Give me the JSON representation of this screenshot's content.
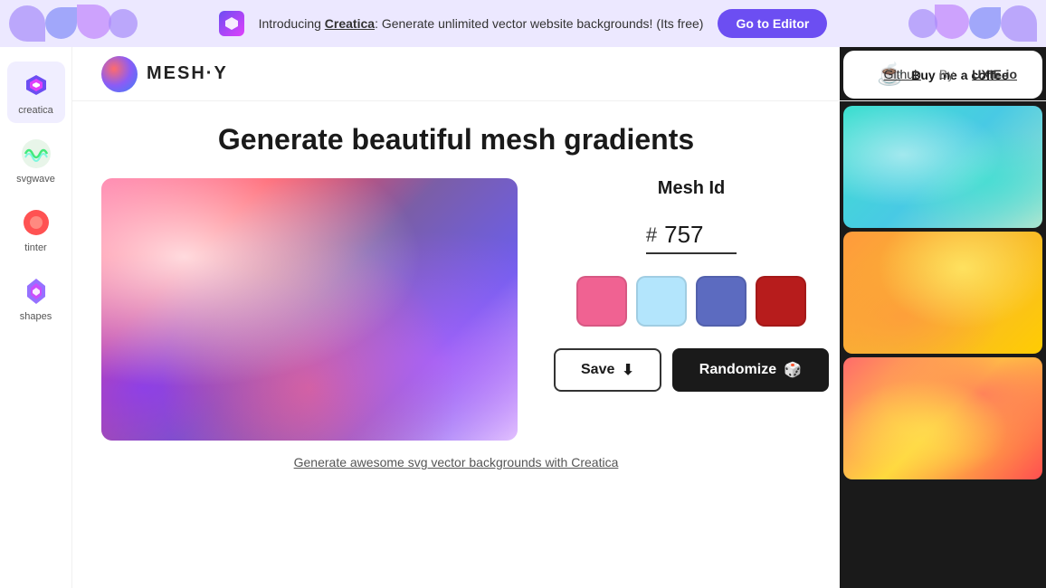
{
  "banner": {
    "text_intro": "Introducing ",
    "brand_name": "Creatica",
    "text_desc": ": Generate unlimited vector website backgrounds! (Its free)",
    "cta_label": "Go to Editor"
  },
  "sidebar": {
    "items": [
      {
        "id": "creatica",
        "label": "creatica"
      },
      {
        "id": "svgwave",
        "label": "svgwave"
      },
      {
        "id": "tinter",
        "label": "tinter"
      },
      {
        "id": "shapes",
        "label": "shapes"
      }
    ]
  },
  "header": {
    "logo_text": "MESH·Y",
    "github_label": "Github",
    "by_text": "By",
    "uxie_label": "UXIE·io"
  },
  "main": {
    "title": "Generate beautiful mesh gradients",
    "mesh_id_label": "Mesh Id",
    "hash_symbol": "#",
    "mesh_id_value": "757",
    "color_swatches": [
      {
        "color": "#f06292",
        "label": "pink"
      },
      {
        "color": "#b3e5fc",
        "label": "light-blue"
      },
      {
        "color": "#5c6bc0",
        "label": "purple"
      },
      {
        "color": "#b71c1c",
        "label": "dark-red"
      }
    ],
    "save_label": "Save",
    "randomize_label": "Randomize",
    "footer_link": "Generate awesome svg vector backgrounds with Creatica"
  },
  "right_panel": {
    "coffee_text": "Buy me a coffee",
    "thumbnails": [
      {
        "id": "thumb-teal",
        "class": "thumb-1"
      },
      {
        "id": "thumb-orange",
        "class": "thumb-2"
      },
      {
        "id": "thumb-red",
        "class": "thumb-3"
      }
    ]
  }
}
